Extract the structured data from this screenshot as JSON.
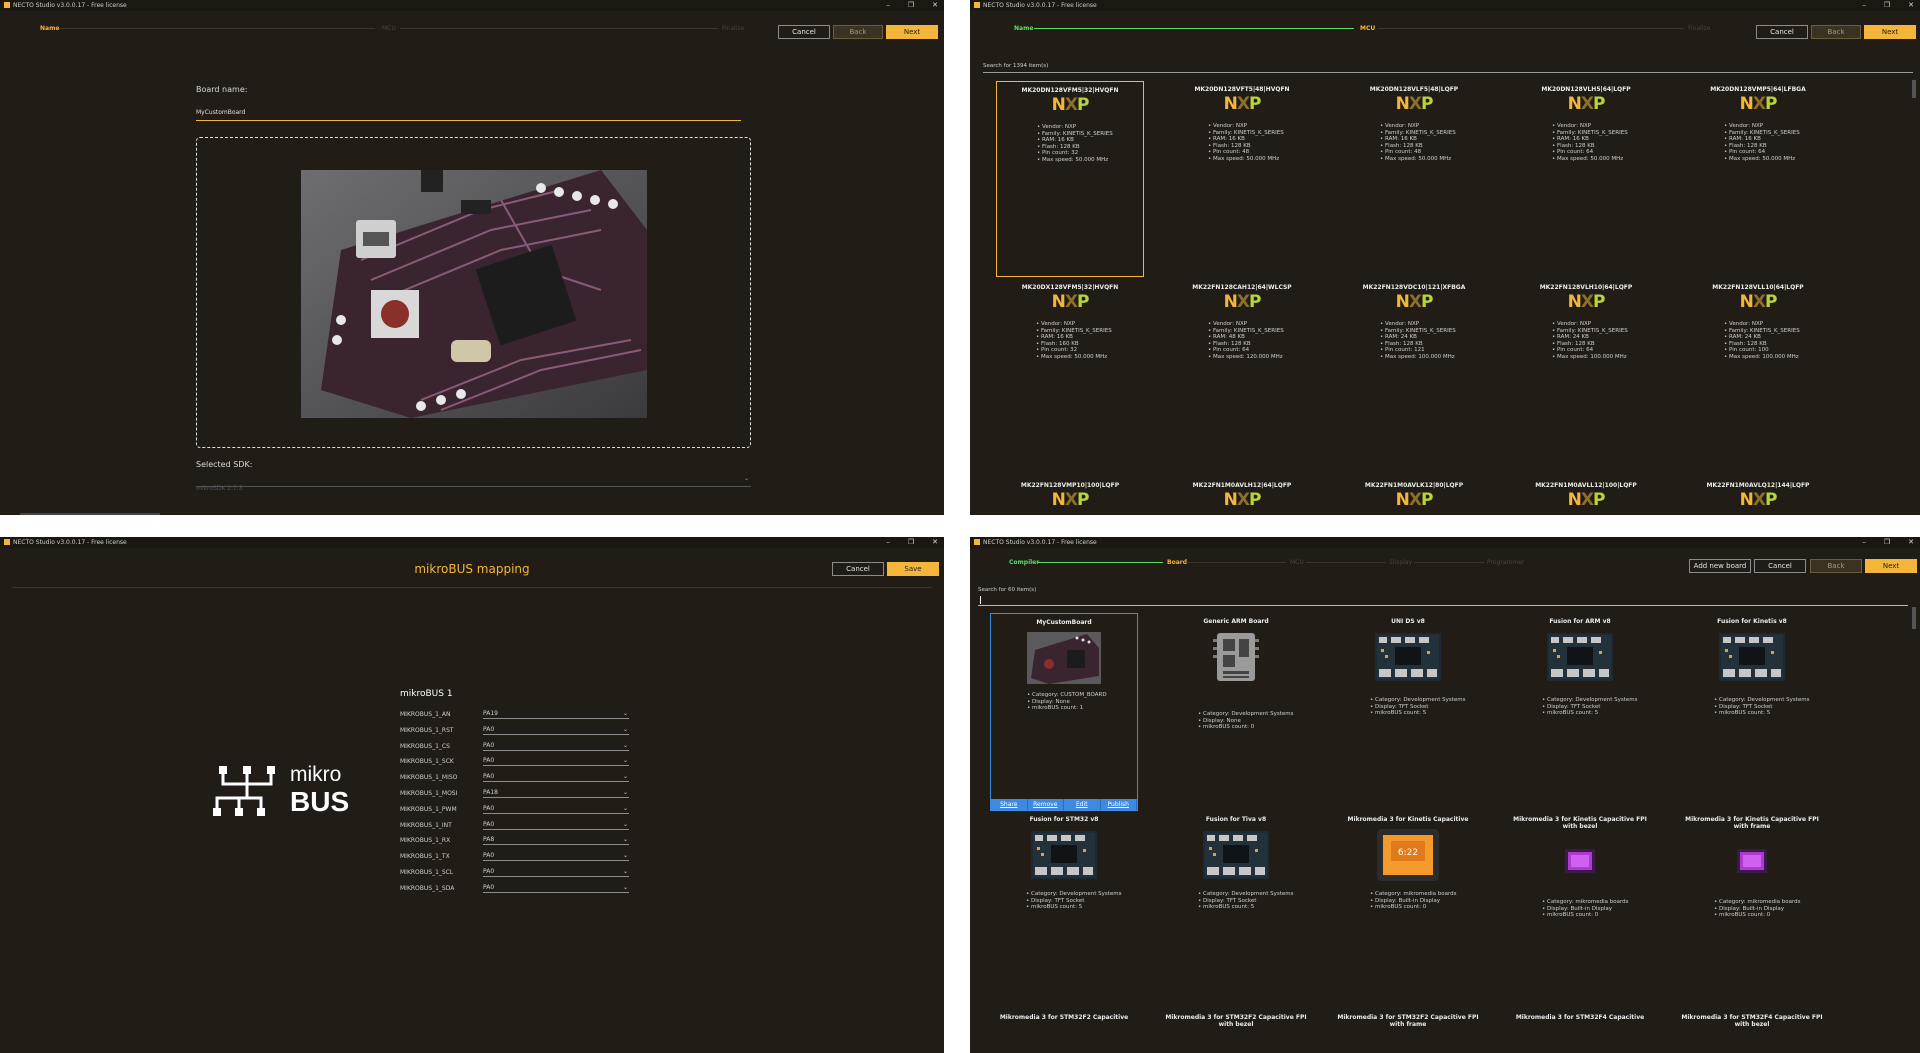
{
  "app": {
    "window_title": "NECTO Studio v3.0.0.17 - Free license"
  },
  "window_controls": {
    "minimize": "–",
    "maximize": "❐",
    "close": "✕"
  },
  "panel1": {
    "steps": [
      "Name",
      "MCU",
      "Finalize"
    ],
    "buttons": {
      "cancel": "Cancel",
      "back": "Back",
      "next": "Next"
    },
    "board_name_label": "Board name:",
    "board_name_value": "MyCustomBoard",
    "selected_sdk_label": "Selected SDK:",
    "selected_sdk_value": "mikroSDK 2.7.3"
  },
  "panel2": {
    "steps": [
      "Name",
      "MCU",
      "Finalize"
    ],
    "buttons": {
      "cancel": "Cancel",
      "back": "Back",
      "next": "Next"
    },
    "search_text": "Search for 1394 item(s)",
    "mcus": [
      {
        "name": "MK20DN128VFM5|32|HVQFN",
        "vendor": "NXP",
        "family": "KINETIS_K_SERIES",
        "ram": "16 KB",
        "flash": "128 KB",
        "pins": "32",
        "speed": "50.000 MHz"
      },
      {
        "name": "MK20DN128VFT5|48|HVQFN",
        "vendor": "NXP",
        "family": "KINETIS_K_SERIES",
        "ram": "16 KB",
        "flash": "128 KB",
        "pins": "48",
        "speed": "50.000 MHz"
      },
      {
        "name": "MK20DN128VLF5|48|LQFP",
        "vendor": "NXP",
        "family": "KINETIS_K_SERIES",
        "ram": "16 KB",
        "flash": "128 KB",
        "pins": "48",
        "speed": "50.000 MHz"
      },
      {
        "name": "MK20DN128VLH5|64|LQFP",
        "vendor": "NXP",
        "family": "KINETIS_K_SERIES",
        "ram": "16 KB",
        "flash": "128 KB",
        "pins": "64",
        "speed": "50.000 MHz"
      },
      {
        "name": "MK20DN128VMP5|64|LFBGA",
        "vendor": "NXP",
        "family": "KINETIS_K_SERIES",
        "ram": "16 KB",
        "flash": "128 KB",
        "pins": "64",
        "speed": "50.000 MHz"
      },
      {
        "name": "MK20DX128VFM5|32|HVQFN",
        "vendor": "NXP",
        "family": "KINETIS_K_SERIES",
        "ram": "16 KB",
        "flash": "160 KB",
        "pins": "32",
        "speed": "50.000 MHz"
      },
      {
        "name": "MK22FN128CAH12|64|WLCSP",
        "vendor": "NXP",
        "family": "KINETIS_K_SERIES",
        "ram": "48 KB",
        "flash": "128 KB",
        "pins": "64",
        "speed": "120.000 MHz"
      },
      {
        "name": "MK22FN128VDC10|121|XFBGA",
        "vendor": "NXP",
        "family": "KINETIS_K_SERIES",
        "ram": "24 KB",
        "flash": "128 KB",
        "pins": "121",
        "speed": "100.000 MHz"
      },
      {
        "name": "MK22FN128VLH10|64|LQFP",
        "vendor": "NXP",
        "family": "KINETIS_K_SERIES",
        "ram": "24 KB",
        "flash": "128 KB",
        "pins": "64",
        "speed": "100.000 MHz"
      },
      {
        "name": "MK22FN128VLL10|64|LQFP",
        "vendor": "NXP",
        "family": "KINETIS_K_SERIES",
        "ram": "24 KB",
        "flash": "128 KB",
        "pins": "100",
        "speed": "100.000 MHz"
      }
    ],
    "mcus_row3": [
      "MK22FN128VMP10|100|LQFP",
      "MK22FN1M0AVLH12|64|LQFP",
      "MK22FN1M0AVLK12|80|LQFP",
      "MK22FN1M0AVLL12|100|LQFP",
      "MK22FN1M0AVLQ12|144|LQFP"
    ],
    "spec_labels": {
      "vendor": "Vendor:",
      "family": "Family:",
      "ram": "RAM:",
      "flash": "Flash:",
      "pins": "Pin count:",
      "speed": "Max speed:"
    },
    "logo_text": {
      "n": "N",
      "x": "X",
      "p": "P"
    }
  },
  "panel3": {
    "title": "mikroBUS mapping",
    "buttons": {
      "cancel": "Cancel",
      "save": "Save"
    },
    "logo_top": "mikro",
    "logo_bottom": "BUS",
    "section": "mikroBUS 1",
    "rows": [
      {
        "pin": "MIKROBUS_1_AN",
        "value": "PA19"
      },
      {
        "pin": "MIKROBUS_1_RST",
        "value": "PA0"
      },
      {
        "pin": "MIKROBUS_1_CS",
        "value": "PA0"
      },
      {
        "pin": "MIKROBUS_1_SCK",
        "value": "PA0"
      },
      {
        "pin": "MIKROBUS_1_MISO",
        "value": "PA0"
      },
      {
        "pin": "MIKROBUS_1_MOSI",
        "value": "PA18"
      },
      {
        "pin": "MIKROBUS_1_PWM",
        "value": "PA0"
      },
      {
        "pin": "MIKROBUS_1_INT",
        "value": "PA0"
      },
      {
        "pin": "MIKROBUS_1_RX",
        "value": "PA8"
      },
      {
        "pin": "MIKROBUS_1_TX",
        "value": "PA0"
      },
      {
        "pin": "MIKROBUS_1_SCL",
        "value": "PA0"
      },
      {
        "pin": "MIKROBUS_1_SDA",
        "value": "PA0"
      }
    ]
  },
  "panel4": {
    "steps": [
      "Compiler",
      "Board",
      "MCU",
      "Display",
      "Programmer"
    ],
    "buttons": {
      "add_new_board": "Add new board",
      "cancel": "Cancel",
      "back": "Back",
      "next": "Next"
    },
    "search_text": "Search for 60 item(s)",
    "boards": [
      {
        "name": "MyCustomBoard",
        "specs": [
          "Category: CUSTOM_BOARD",
          "Display: None",
          "mikroBUS count: 1"
        ],
        "img": "custom"
      },
      {
        "name": "Generic ARM Board",
        "specs": [
          "Category: Development Systems",
          "Display: None",
          "mikroBUS count: 0"
        ],
        "img": "chip"
      },
      {
        "name": "UNI DS v8",
        "specs": [
          "Category: Development Systems",
          "Display: TFT Socket",
          "mikroBUS count: 5"
        ],
        "img": "dev"
      },
      {
        "name": "Fusion for ARM v8",
        "specs": [
          "Category: Development Systems",
          "Display: TFT Socket",
          "mikroBUS count: 5"
        ],
        "img": "dev"
      },
      {
        "name": "Fusion for Kinetis v8",
        "specs": [
          "Category: Development Systems",
          "Display: TFT Socket",
          "mikroBUS count: 5"
        ],
        "img": "dev"
      },
      {
        "name": "Fusion for STM32 v8",
        "specs": [
          "Category: Development Systems",
          "Display: TFT Socket",
          "mikroBUS count: 5"
        ],
        "img": "dev"
      },
      {
        "name": "Fusion for Tiva v8",
        "specs": [
          "Category: Development Systems",
          "Display: TFT Socket",
          "mikroBUS count: 5"
        ],
        "img": "dev"
      },
      {
        "name": "Mikromedia 3 for Kinetis Capacitive",
        "specs": [
          "Category: mikromedia boards",
          "Display: Built-in Display",
          "mikroBUS count: 0"
        ],
        "img": "media"
      },
      {
        "name": "Mikromedia 3 for Kinetis Capacitive FPI with bezel",
        "specs": [
          "Category: mikromedia boards",
          "Display: Built-in Display",
          "mikroBUS count: 0"
        ],
        "img": "small"
      },
      {
        "name": "Mikromedia 3 for Kinetis Capacitive FPI with frame",
        "specs": [
          "Category: mikromedia boards",
          "Display: Built-in Display",
          "mikroBUS count: 0"
        ],
        "img": "small"
      }
    ],
    "boards_row3": [
      "Mikromedia 3 for STM32F2 Capacitive",
      "Mikromedia 3 for STM32F2 Capacitive FPI with bezel",
      "Mikromedia 3 for STM32F2 Capacitive FPI with frame",
      "Mikromedia 3 for STM32F4 Capacitive",
      "Mikromedia 3 for STM32F4 Capacitive FPI with bezel"
    ],
    "actions": [
      "Share",
      "Remove",
      "Edit",
      "Publish"
    ],
    "clock_text": "6:22"
  },
  "colors": {
    "accent": "#f4b63a",
    "background": "#211d16",
    "done": "#5ddc6c",
    "selection_blue": "#3d8ae0"
  }
}
